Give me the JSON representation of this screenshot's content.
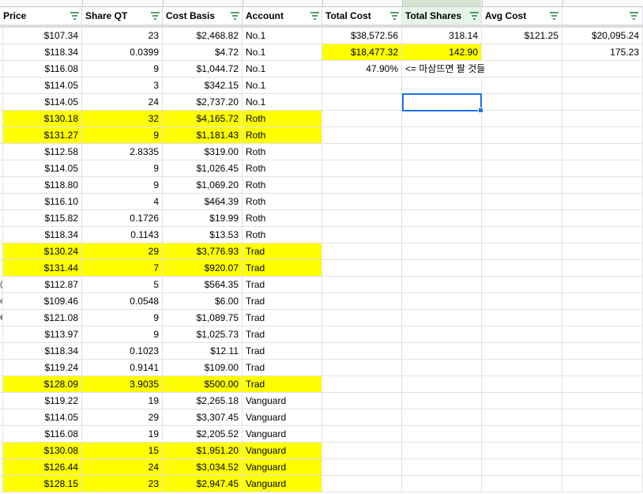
{
  "colors": {
    "highlight": "#ffff00",
    "selection": "#1a73e8",
    "grid": "#e2e2e2"
  },
  "headers": [
    "Price",
    "Share QT",
    "Cost Basis",
    "Account",
    "Total Cost",
    "Total Shares",
    "Avg Cost",
    ""
  ],
  "row_stubs": [
    "",
    "",
    "",
    "",
    "",
    "",
    "",
    "",
    "",
    "",
    "",
    "",
    "",
    "",
    "",
    "(",
    "e",
    "€",
    "",
    "",
    "",
    "",
    "",
    "",
    "",
    "",
    "",
    "",
    ""
  ],
  "rows": [
    {
      "price": "$107.34",
      "qty": "23",
      "cost": "$2,468.82",
      "account": "No.1",
      "hl": false
    },
    {
      "price": "$118.34",
      "qty": "0.0399",
      "cost": "$4.72",
      "account": "No.1",
      "hl": false
    },
    {
      "price": "$116.08",
      "qty": "9",
      "cost": "$1,044.72",
      "account": "No.1",
      "hl": false
    },
    {
      "price": "$114.05",
      "qty": "3",
      "cost": "$342.15",
      "account": "No.1",
      "hl": false
    },
    {
      "price": "$114.05",
      "qty": "24",
      "cost": "$2,737.20",
      "account": "No.1",
      "hl": false
    },
    {
      "price": "$130.18",
      "qty": "32",
      "cost": "$4,165.72",
      "account": "Roth",
      "hl": true
    },
    {
      "price": "$131.27",
      "qty": "9",
      "cost": "$1,181.43",
      "account": "Roth",
      "hl": true
    },
    {
      "price": "$112.58",
      "qty": "2.8335",
      "cost": "$319.00",
      "account": "Roth",
      "hl": false
    },
    {
      "price": "$114.05",
      "qty": "9",
      "cost": "$1,026.45",
      "account": "Roth",
      "hl": false
    },
    {
      "price": "$118.80",
      "qty": "9",
      "cost": "$1,069.20",
      "account": "Roth",
      "hl": false
    },
    {
      "price": "$116.10",
      "qty": "4",
      "cost": "$464.39",
      "account": "Roth",
      "hl": false
    },
    {
      "price": "$115.82",
      "qty": "0.1726",
      "cost": "$19.99",
      "account": "Roth",
      "hl": false
    },
    {
      "price": "$118.34",
      "qty": "0.1143",
      "cost": "$13.53",
      "account": "Roth",
      "hl": false
    },
    {
      "price": "$130.24",
      "qty": "29",
      "cost": "$3,776.93",
      "account": "Trad",
      "hl": true
    },
    {
      "price": "$131.44",
      "qty": "7",
      "cost": "$920.07",
      "account": "Trad",
      "hl": true
    },
    {
      "price": "$112.87",
      "qty": "5",
      "cost": "$564.35",
      "account": "Trad",
      "hl": false
    },
    {
      "price": "$109.46",
      "qty": "0.0548",
      "cost": "$6.00",
      "account": "Trad",
      "hl": false
    },
    {
      "price": "$121.08",
      "qty": "9",
      "cost": "$1,089.75",
      "account": "Trad",
      "hl": false
    },
    {
      "price": "$113.97",
      "qty": "9",
      "cost": "$1,025.73",
      "account": "Trad",
      "hl": false
    },
    {
      "price": "$118.34",
      "qty": "0.1023",
      "cost": "$12.11",
      "account": "Trad",
      "hl": false
    },
    {
      "price": "$119.24",
      "qty": "0.9141",
      "cost": "$109.00",
      "account": "Trad",
      "hl": false
    },
    {
      "price": "$128.09",
      "qty": "3.9035",
      "cost": "$500.00",
      "account": "Trad",
      "hl": true
    },
    {
      "price": "$119.22",
      "qty": "19",
      "cost": "$2,265.18",
      "account": "Vanguard",
      "hl": false
    },
    {
      "price": "$114.05",
      "qty": "29",
      "cost": "$3,307.45",
      "account": "Vanguard",
      "hl": false
    },
    {
      "price": "$116.08",
      "qty": "19",
      "cost": "$2,205.52",
      "account": "Vanguard",
      "hl": false
    },
    {
      "price": "$130.08",
      "qty": "15",
      "cost": "$1,951.20",
      "account": "Vanguard",
      "hl": true
    },
    {
      "price": "$126.44",
      "qty": "24",
      "cost": "$3,034.52",
      "account": "Vanguard",
      "hl": true
    },
    {
      "price": "$128.15",
      "qty": "23",
      "cost": "$2,947.45",
      "account": "Vanguard",
      "hl": true
    }
  ],
  "summary": [
    {
      "total_cost": "$38,572.56",
      "total_shares": "318.14",
      "avg_cost": "$121.25",
      "extra": "$20,095.24",
      "hl": false
    },
    {
      "total_cost": "$18,477.32",
      "total_shares": "142.90",
      "avg_cost": "",
      "extra": "175.23",
      "hl": true
    },
    {
      "total_cost": "47.90%",
      "total_shares": "<= 마삼뜨면 팔 것들",
      "avg_cost": "",
      "extra": "",
      "hl": false
    }
  ]
}
